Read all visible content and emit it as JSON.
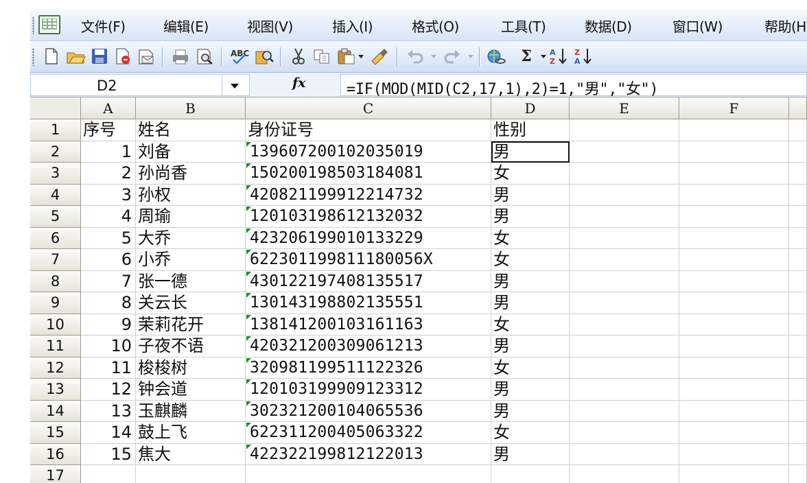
{
  "menu": {
    "items": [
      "文件(F)",
      "编辑(E)",
      "视图(V)",
      "插入(I)",
      "格式(O)",
      "工具(T)",
      "数据(D)",
      "窗口(W)",
      "帮助(H)"
    ]
  },
  "toolbar": {
    "buttons": [
      "new-icon",
      "open-icon",
      "save-icon",
      "permission-icon",
      "email-icon",
      "print-icon",
      "print-preview-icon",
      "spelling-icon",
      "research-icon",
      "cut-icon",
      "copy-icon",
      "paste-icon",
      "format-painter-icon",
      "undo-icon",
      "redo-icon",
      "hyperlink-icon",
      "autosum-icon",
      "sort-ascending-icon",
      "sort-descending-icon"
    ],
    "autosum_glyph": "Σ"
  },
  "formula_bar": {
    "name_box": "D2",
    "fx_label": "fx",
    "formula": "=IF(MOD(MID(C2,17,1),2)=1,\"男\",\"女\")"
  },
  "sheet": {
    "columns": [
      "A",
      "B",
      "C",
      "D",
      "E",
      "F"
    ],
    "header_row": [
      "序号",
      "姓名",
      "身份证号",
      "性别"
    ],
    "rows": [
      {
        "no": "1",
        "name": "刘备",
        "id": "139607200102035019",
        "gender": "男"
      },
      {
        "no": "2",
        "name": "孙尚香",
        "id": "150200198503184081",
        "gender": "女"
      },
      {
        "no": "3",
        "name": "孙权",
        "id": "420821199912214732",
        "gender": "男"
      },
      {
        "no": "4",
        "name": "周瑜",
        "id": "120103198612132032",
        "gender": "男"
      },
      {
        "no": "5",
        "name": "大乔",
        "id": "423206199010133229",
        "gender": "女"
      },
      {
        "no": "6",
        "name": "小乔",
        "id": "622301199811180056X",
        "gender": "女"
      },
      {
        "no": "7",
        "name": "张一德",
        "id": "430122197408135517",
        "gender": "男"
      },
      {
        "no": "8",
        "name": "关云长",
        "id": "130143198802135551",
        "gender": "男"
      },
      {
        "no": "9",
        "name": "茉莉花开",
        "id": "138141200103161163",
        "gender": "女"
      },
      {
        "no": "10",
        "name": "子夜不语",
        "id": "420321200309061213",
        "gender": "男"
      },
      {
        "no": "11",
        "name": "梭梭树",
        "id": "320981199511122326",
        "gender": "女"
      },
      {
        "no": "12",
        "name": "钟会道",
        "id": "120103199909123312",
        "gender": "男"
      },
      {
        "no": "13",
        "name": "玉麒麟",
        "id": "302321200104065536",
        "gender": "男"
      },
      {
        "no": "14",
        "name": "鼓上飞",
        "id": "622311200405063322",
        "gender": "女"
      },
      {
        "no": "15",
        "name": "焦大",
        "id": "422322199812122013",
        "gender": "男"
      }
    ],
    "row_numbers": [
      "1",
      "2",
      "3",
      "4",
      "5",
      "6",
      "7",
      "8",
      "9",
      "10",
      "11",
      "12",
      "13",
      "14",
      "15",
      "16",
      "17"
    ],
    "selected_cell": "D2"
  }
}
